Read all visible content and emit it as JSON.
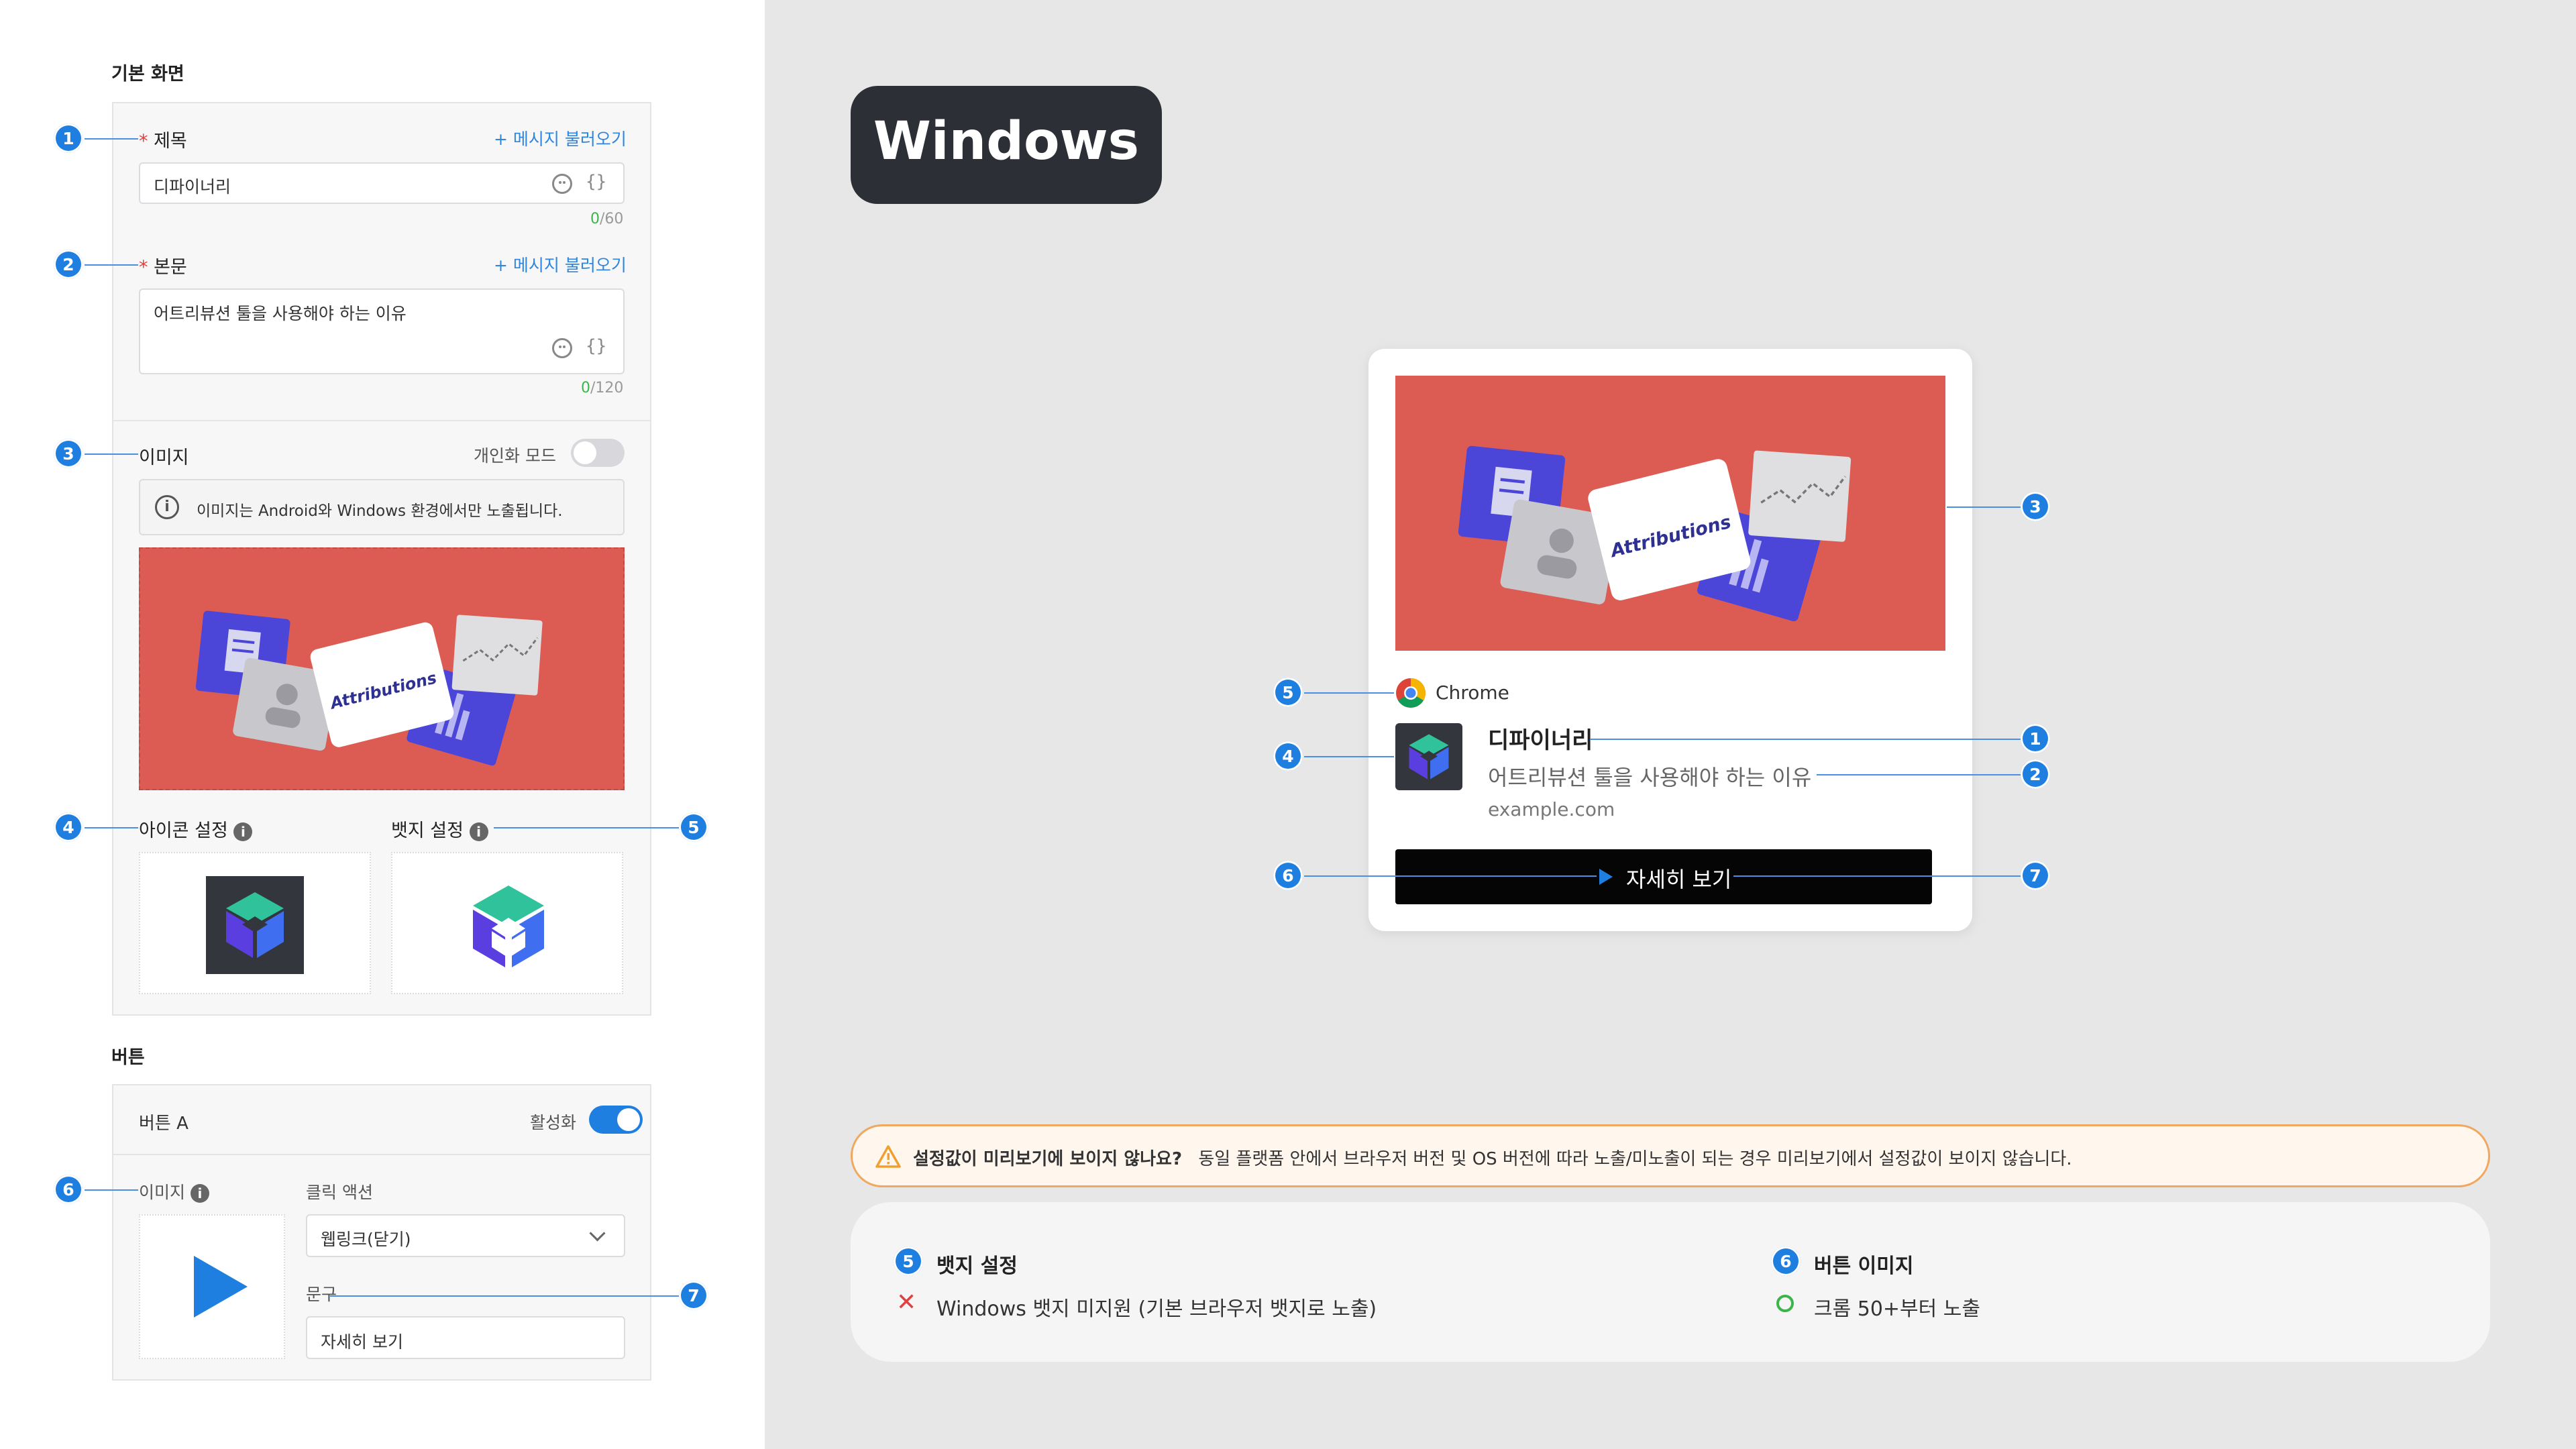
{
  "left": {
    "section_basic": "기본 화면",
    "title_label": "제목",
    "title_load": "+ 메시지 불러오기",
    "title_value": "디파이너리",
    "title_count_used": "0",
    "title_count_max": "/60",
    "body_label": "본문",
    "body_load": "+ 메시지 불러오기",
    "body_value": "어트리뷰션 툴을 사용해야 하는 이유",
    "body_count_used": "0",
    "body_count_max": "/120",
    "image_label": "이미지",
    "personal_mode": "개인화 모드",
    "image_notice": "이미지는 Android와 Windows 환경에서만 노출됩니다.",
    "icon_setting": "아이콘 설정",
    "badge_setting": "뱃지 설정",
    "section_button": "버튼",
    "button_a": "버튼 A",
    "activate": "활성화",
    "btn_image_label": "이미지",
    "click_action_label": "클릭 액션",
    "click_action_value": "웹링크(닫기)",
    "phrase_label": "문구",
    "phrase_value": "자세히 보기"
  },
  "banner": {
    "attributions_text": "Attributions"
  },
  "platform_title": "Windows",
  "preview": {
    "browser": "Chrome",
    "title": "디파이너리",
    "body": "어트리뷰션 툴을 사용해야 하는 이유",
    "url": "example.com",
    "button": "자세히 보기"
  },
  "markers": [
    "1",
    "2",
    "3",
    "4",
    "5",
    "6",
    "7"
  ],
  "notice": {
    "strong": "설정값이 미리보기에 보이지 않나요?",
    "text": "동일 플랫폼 안에서 브라우저 버전 및 OS 버전에 따라 노출/미노출이 되는 경우 미리보기에서 설정값이 보이지 않습니다."
  },
  "info": {
    "badge_title": "뱃지 설정",
    "badge_desc": "Windows 뱃지 미지원 (기본 브라우저 뱃지로 노출)",
    "button_title": "버튼 이미지",
    "button_desc": "크롬 50+부터 노출"
  },
  "colors": {
    "banner": "#dc5b53",
    "marker": "#1f7fe0",
    "toggle_on": "#1f7fe0",
    "notice_border": "#f0a860",
    "notice_bg": "#fff6ee"
  }
}
